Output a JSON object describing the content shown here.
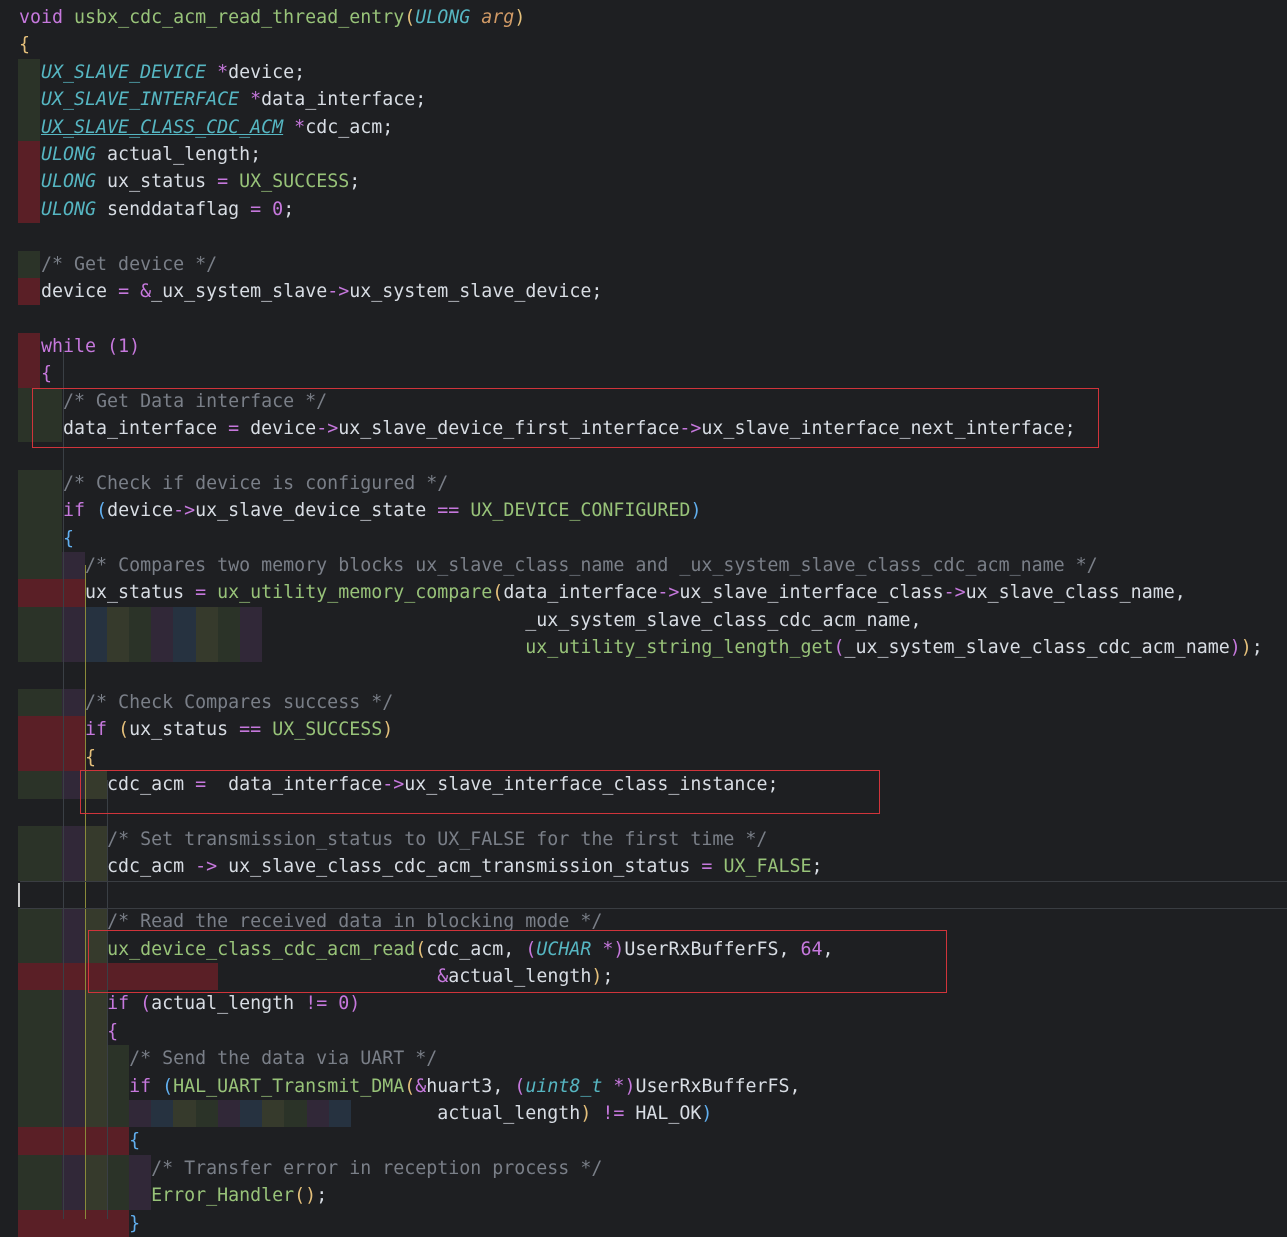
{
  "colors": {
    "background": "#1e1f22",
    "keyword": "#c678dd",
    "type": "#56b6c2",
    "function": "#98c379",
    "comment": "#7a7f88",
    "highlight-box": "#d0343b",
    "indent-error": "#5a1f26",
    "indent-green": "#2b3328",
    "indent-purple": "#312838",
    "indent-blue": "#263240",
    "indent-olive": "#363a2c"
  },
  "lines": [
    {
      "i": 0,
      "ind": [],
      "tok": [
        [
          "k",
          "void"
        ],
        [
          "v",
          " "
        ],
        [
          "f",
          "usbx_cdc_acm_read_thread_entry"
        ],
        [
          "b1",
          "("
        ],
        [
          "t",
          "ULONG"
        ],
        [
          "v",
          " "
        ],
        [
          "p",
          "arg"
        ],
        [
          "b1",
          ")"
        ]
      ]
    },
    {
      "i": 1,
      "ind": [],
      "tok": [
        [
          "b1",
          "{"
        ]
      ]
    },
    {
      "i": 2,
      "ind": [
        "G"
      ],
      "tok": [
        [
          "v",
          "  "
        ],
        [
          "t",
          "UX_SLAVE_DEVICE"
        ],
        [
          "v",
          " "
        ],
        [
          "o",
          "*"
        ],
        [
          "v",
          "device;"
        ]
      ]
    },
    {
      "i": 3,
      "ind": [
        "G"
      ],
      "tok": [
        [
          "v",
          "  "
        ],
        [
          "t",
          "UX_SLAVE_INTERFACE"
        ],
        [
          "v",
          " "
        ],
        [
          "o",
          "*"
        ],
        [
          "v",
          "data_interface;"
        ]
      ]
    },
    {
      "i": 4,
      "ind": [
        "G"
      ],
      "tok": [
        [
          "v",
          "  "
        ],
        [
          "tu",
          "UX_SLAVE_CLASS_CDC_ACM"
        ],
        [
          "v",
          " "
        ],
        [
          "o",
          "*"
        ],
        [
          "v",
          "cdc_acm;"
        ]
      ]
    },
    {
      "i": 5,
      "ind": [
        "R"
      ],
      "tok": [
        [
          "v",
          "  "
        ],
        [
          "t",
          "ULONG"
        ],
        [
          "v",
          " actual_length;"
        ]
      ]
    },
    {
      "i": 6,
      "ind": [
        "R"
      ],
      "tok": [
        [
          "v",
          "  "
        ],
        [
          "t",
          "ULONG"
        ],
        [
          "v",
          " ux_status "
        ],
        [
          "o",
          "="
        ],
        [
          "v",
          " "
        ],
        [
          "m",
          "UX_SUCCESS"
        ],
        [
          "v",
          ";"
        ]
      ]
    },
    {
      "i": 7,
      "ind": [
        "R"
      ],
      "tok": [
        [
          "v",
          "  "
        ],
        [
          "t",
          "ULONG"
        ],
        [
          "v",
          " senddataflag "
        ],
        [
          "o",
          "="
        ],
        [
          "v",
          " "
        ],
        [
          "n",
          "0"
        ],
        [
          "v",
          ";"
        ]
      ]
    },
    {
      "i": 8,
      "ind": [],
      "tok": []
    },
    {
      "i": 9,
      "ind": [
        "G"
      ],
      "tok": [
        [
          "v",
          "  "
        ],
        [
          "c",
          "/* Get device */"
        ]
      ]
    },
    {
      "i": 10,
      "ind": [
        "R"
      ],
      "tok": [
        [
          "v",
          "  device "
        ],
        [
          "o",
          "="
        ],
        [
          "v",
          " "
        ],
        [
          "o",
          "&"
        ],
        [
          "v",
          "_ux_system_slave"
        ],
        [
          "o",
          "->"
        ],
        [
          "v",
          "ux_system_slave_device;"
        ]
      ]
    },
    {
      "i": 11,
      "ind": [],
      "tok": []
    },
    {
      "i": 12,
      "ind": [
        "R"
      ],
      "tok": [
        [
          "v",
          "  "
        ],
        [
          "k",
          "while"
        ],
        [
          "v",
          " "
        ],
        [
          "b2",
          "("
        ],
        [
          "n",
          "1"
        ],
        [
          "b2",
          ")"
        ]
      ]
    },
    {
      "i": 13,
      "ind": [
        "R"
      ],
      "tok": [
        [
          "v",
          "  "
        ],
        [
          "b2",
          "{"
        ]
      ]
    },
    {
      "i": 14,
      "ind": [
        "G",
        "G"
      ],
      "tok": [
        [
          "v",
          "    "
        ],
        [
          "c",
          "/* Get Data interface */"
        ]
      ]
    },
    {
      "i": 15,
      "ind": [
        "G",
        "G"
      ],
      "tok": [
        [
          "v",
          "    data_interface "
        ],
        [
          "o",
          "="
        ],
        [
          "v",
          " device"
        ],
        [
          "o",
          "->"
        ],
        [
          "v",
          "ux_slave_device_first_interface"
        ],
        [
          "o",
          "->"
        ],
        [
          "v",
          "ux_slave_interface_next_interface;"
        ]
      ]
    },
    {
      "i": 16,
      "ind": [],
      "tok": []
    },
    {
      "i": 17,
      "ind": [
        "G",
        "G"
      ],
      "tok": [
        [
          "v",
          "    "
        ],
        [
          "c",
          "/* Check if device is configured */"
        ]
      ]
    },
    {
      "i": 18,
      "ind": [
        "G",
        "G"
      ],
      "tok": [
        [
          "v",
          "    "
        ],
        [
          "k",
          "if"
        ],
        [
          "v",
          " "
        ],
        [
          "b3",
          "("
        ],
        [
          "v",
          "device"
        ],
        [
          "o",
          "->"
        ],
        [
          "v",
          "ux_slave_device_state "
        ],
        [
          "o",
          "=="
        ],
        [
          "v",
          " "
        ],
        [
          "m",
          "UX_DEVICE_CONFIGURED"
        ],
        [
          "b3",
          ")"
        ]
      ]
    },
    {
      "i": 19,
      "ind": [
        "G",
        "G"
      ],
      "tok": [
        [
          "v",
          "    "
        ],
        [
          "b3",
          "{"
        ]
      ]
    },
    {
      "i": 20,
      "ind": [
        "G",
        "G",
        "P"
      ],
      "tok": [
        [
          "v",
          "      "
        ],
        [
          "c",
          "/* Compares two memory blocks ux_slave_class_name and _ux_system_slave_class_cdc_acm_name */"
        ]
      ]
    },
    {
      "i": 21,
      "ind": [
        "R",
        "R",
        "R"
      ],
      "tok": [
        [
          "v",
          "      ux_status "
        ],
        [
          "o",
          "="
        ],
        [
          "v",
          " "
        ],
        [
          "f",
          "ux_utility_memory_compare"
        ],
        [
          "b1",
          "("
        ],
        [
          "v",
          "data_interface"
        ],
        [
          "o",
          "->"
        ],
        [
          "v",
          "ux_slave_interface_class"
        ],
        [
          "o",
          "->"
        ],
        [
          "v",
          "ux_slave_class_name,"
        ]
      ]
    },
    {
      "i": 22,
      "ind": [
        "G",
        "G",
        "P",
        "B",
        "O",
        "G",
        "P",
        "B",
        "O",
        "G",
        "P"
      ],
      "tok": [
        [
          "v",
          "                                              _ux_system_slave_class_cdc_acm_name,"
        ]
      ]
    },
    {
      "i": 23,
      "ind": [
        "G",
        "G",
        "P",
        "B",
        "O",
        "G",
        "P",
        "B",
        "O",
        "G",
        "P"
      ],
      "tok": [
        [
          "v",
          "                                              "
        ],
        [
          "f",
          "ux_utility_string_length_get"
        ],
        [
          "b2",
          "("
        ],
        [
          "v",
          "_ux_system_slave_class_cdc_acm_name"
        ],
        [
          "b2",
          ")"
        ],
        [
          "b1",
          ")"
        ],
        [
          "v",
          ";"
        ]
      ]
    },
    {
      "i": 24,
      "ind": [],
      "tok": []
    },
    {
      "i": 25,
      "ind": [
        "G",
        "G",
        "P"
      ],
      "tok": [
        [
          "v",
          "      "
        ],
        [
          "c",
          "/* Check Compares success */"
        ]
      ]
    },
    {
      "i": 26,
      "ind": [
        "R",
        "R",
        "R"
      ],
      "tok": [
        [
          "v",
          "      "
        ],
        [
          "k",
          "if"
        ],
        [
          "v",
          " "
        ],
        [
          "b1",
          "("
        ],
        [
          "v",
          "ux_status "
        ],
        [
          "o",
          "=="
        ],
        [
          "v",
          " "
        ],
        [
          "m",
          "UX_SUCCESS"
        ],
        [
          "b1",
          ")"
        ]
      ]
    },
    {
      "i": 27,
      "ind": [
        "R",
        "R",
        "R"
      ],
      "tok": [
        [
          "v",
          "      "
        ],
        [
          "b1",
          "{"
        ]
      ]
    },
    {
      "i": 28,
      "ind": [
        "G",
        "G",
        "P",
        "O"
      ],
      "tok": [
        [
          "v",
          "        cdc_acm "
        ],
        [
          "o",
          "="
        ],
        [
          "v",
          "  data_interface"
        ],
        [
          "o",
          "->"
        ],
        [
          "v",
          "ux_slave_interface_class_instance;"
        ]
      ]
    },
    {
      "i": 29,
      "ind": [],
      "tok": []
    },
    {
      "i": 30,
      "ind": [
        "G",
        "G",
        "P",
        "O"
      ],
      "tok": [
        [
          "v",
          "        "
        ],
        [
          "c",
          "/* Set transmission_status to UX_FALSE for the first time */"
        ]
      ]
    },
    {
      "i": 31,
      "ind": [
        "G",
        "G",
        "P",
        "O"
      ],
      "tok": [
        [
          "v",
          "        cdc_acm "
        ],
        [
          "o",
          "->"
        ],
        [
          "v",
          " ux_slave_class_cdc_acm_transmission_status "
        ],
        [
          "o",
          "="
        ],
        [
          "v",
          " "
        ],
        [
          "m",
          "UX_FALSE"
        ],
        [
          "v",
          ";"
        ]
      ]
    },
    {
      "i": 32,
      "ind": [],
      "tok": []
    },
    {
      "i": 33,
      "ind": [
        "G",
        "G",
        "P",
        "O"
      ],
      "tok": [
        [
          "v",
          "        "
        ],
        [
          "c",
          "/* Read the received data in blocking mode */"
        ]
      ]
    },
    {
      "i": 34,
      "ind": [
        "G",
        "G",
        "P",
        "O"
      ],
      "tok": [
        [
          "v",
          "        "
        ],
        [
          "f",
          "ux_device_class_cdc_acm_read"
        ],
        [
          "b1",
          "("
        ],
        [
          "v",
          "cdc_acm, "
        ],
        [
          "b2",
          "("
        ],
        [
          "t",
          "UCHAR"
        ],
        [
          "v",
          " "
        ],
        [
          "o",
          "*"
        ],
        [
          "b2",
          ")"
        ],
        [
          "v",
          "UserRxBufferFS, "
        ],
        [
          "n",
          "64"
        ],
        [
          "v",
          ","
        ]
      ]
    },
    {
      "i": 35,
      "ind": [
        "R",
        "R",
        "R",
        "R",
        "R",
        "R",
        "R",
        "R",
        "R"
      ],
      "tok": [
        [
          "v",
          "                                      "
        ],
        [
          "o",
          "&"
        ],
        [
          "v",
          "actual_length"
        ],
        [
          "b1",
          ")"
        ],
        [
          "v",
          ";"
        ]
      ]
    },
    {
      "i": 36,
      "ind": [
        "G",
        "G",
        "P",
        "O"
      ],
      "tok": [
        [
          "v",
          "        "
        ],
        [
          "k",
          "if"
        ],
        [
          "v",
          " "
        ],
        [
          "b2",
          "("
        ],
        [
          "v",
          "actual_length "
        ],
        [
          "o",
          "!="
        ],
        [
          "v",
          " "
        ],
        [
          "n",
          "0"
        ],
        [
          "b2",
          ")"
        ]
      ]
    },
    {
      "i": 37,
      "ind": [
        "G",
        "G",
        "P",
        "O"
      ],
      "tok": [
        [
          "v",
          "        "
        ],
        [
          "b2",
          "{"
        ]
      ]
    },
    {
      "i": 38,
      "ind": [
        "G",
        "G",
        "P",
        "O",
        "G"
      ],
      "tok": [
        [
          "v",
          "          "
        ],
        [
          "c",
          "/* Send the data via UART */"
        ]
      ]
    },
    {
      "i": 39,
      "ind": [
        "G",
        "G",
        "P",
        "O",
        "G"
      ],
      "tok": [
        [
          "v",
          "          "
        ],
        [
          "k",
          "if"
        ],
        [
          "v",
          " "
        ],
        [
          "b3",
          "("
        ],
        [
          "f",
          "HAL_UART_Transmit_DMA"
        ],
        [
          "b1",
          "("
        ],
        [
          "o",
          "&"
        ],
        [
          "v",
          "huart3, "
        ],
        [
          "b2",
          "("
        ],
        [
          "t",
          "uint8_t"
        ],
        [
          "v",
          " "
        ],
        [
          "o",
          "*"
        ],
        [
          "b2",
          ")"
        ],
        [
          "v",
          "UserRxBufferFS,"
        ]
      ]
    },
    {
      "i": 40,
      "ind": [
        "G",
        "G",
        "P",
        "O",
        "G",
        "P",
        "B",
        "O",
        "G",
        "P",
        "B",
        "O",
        "G",
        "P",
        "B"
      ],
      "tok": [
        [
          "v",
          "                                      actual_length"
        ],
        [
          "b1",
          ")"
        ],
        [
          "v",
          " "
        ],
        [
          "o",
          "!="
        ],
        [
          "v",
          " HAL_OK"
        ],
        [
          "b3",
          ")"
        ]
      ]
    },
    {
      "i": 41,
      "ind": [
        "R",
        "R",
        "R",
        "R",
        "R"
      ],
      "tok": [
        [
          "v",
          "          "
        ],
        [
          "b3",
          "{"
        ]
      ]
    },
    {
      "i": 42,
      "ind": [
        "G",
        "G",
        "P",
        "O",
        "G",
        "P"
      ],
      "tok": [
        [
          "v",
          "            "
        ],
        [
          "c",
          "/* Transfer error in reception process */"
        ]
      ]
    },
    {
      "i": 43,
      "ind": [
        "G",
        "G",
        "P",
        "O",
        "G",
        "P"
      ],
      "tok": [
        [
          "v",
          "            "
        ],
        [
          "f",
          "Error_Handler"
        ],
        [
          "b1",
          "()"
        ],
        [
          "v",
          ";"
        ]
      ]
    },
    {
      "i": 44,
      "ind": [
        "R",
        "R",
        "R",
        "R",
        "R"
      ],
      "tok": [
        [
          "v",
          "          "
        ],
        [
          "b3",
          "}"
        ]
      ]
    }
  ]
}
